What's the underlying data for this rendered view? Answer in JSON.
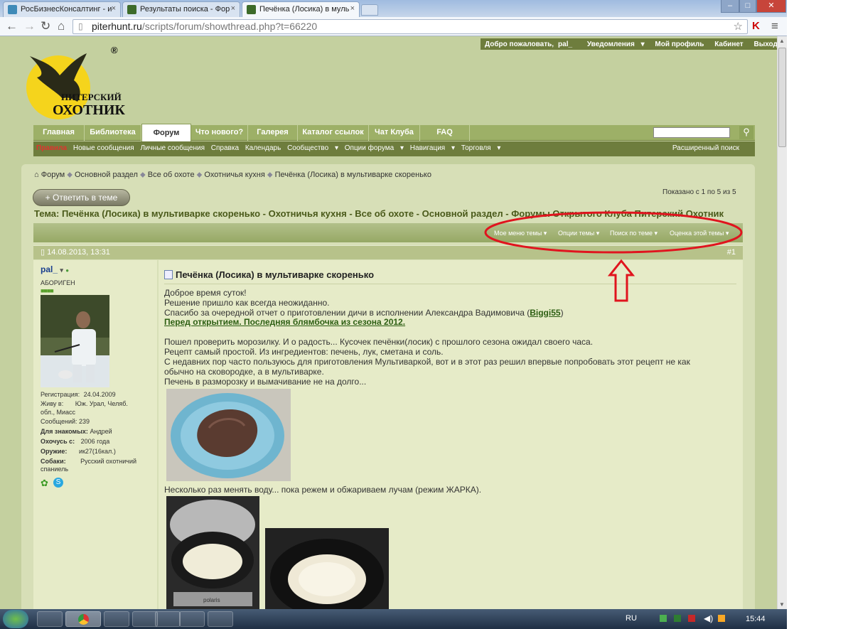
{
  "browser": {
    "tabs": [
      {
        "title": "РосБизнесКонсалтинг - и"
      },
      {
        "title": "Результаты поиска - Фор"
      },
      {
        "title": "Печёнка (Лосика) в муль"
      }
    ],
    "tab_close": "×",
    "url_host": "piterhunt.ru",
    "url_path": "/scripts/forum/showthread.php?t=66220"
  },
  "site": {
    "logo_text": "ПИТЕРСКИЙ ОХОТНИК",
    "registered_mark": "®",
    "userbar": {
      "welcome": "Добро пожаловать,",
      "username": "pal_",
      "notifications": "Уведомления",
      "profile": "Мой профиль",
      "cabinet": "Кабинет",
      "logout": "Выход"
    },
    "nav_tabs": [
      "Главная",
      "Библиотека",
      "Форум",
      "Что нового?",
      "Галерея",
      "Каталог ссылок",
      "Чат Клуба",
      "FAQ"
    ],
    "subnav": [
      "Правила",
      "Новые сообщения",
      "Личные сообщения",
      "Справка",
      "Календарь",
      "Сообщество",
      "Опции форума",
      "Навигация",
      "Торговля"
    ],
    "advanced_search": "Расширенный поиск"
  },
  "breadcrumb": [
    "Форум",
    "Основной раздел",
    "Все об охоте",
    "Охотничья кухня",
    "Печёнка (Лосика) в мультиварке скоренько"
  ],
  "reply_button": "Ответить в теме",
  "showing": "Показано с 1 по 5 из 5",
  "thread_title": "Тема: Печёнка (Лосика) в мультиварке скоренько - Охотничья кухня - Все об охоте - Основной раздел - Форумы Открытого Клуба Питерский Охотник",
  "thread_tools": [
    "Мое меню темы",
    "Опции темы",
    "Поиск по теме",
    "Оценка этой темы"
  ],
  "post": {
    "date": "14.08.2013, 13:31",
    "number": "#1",
    "author": "pal_",
    "rank": "АБОРИГЕН",
    "reg_label": "Регистрация:",
    "reg_value": "24.04.2009",
    "live_label": "Живу в:",
    "live_value": "Юж. Урал, Челяб.",
    "live_value2": "обл., Миасс",
    "posts_label": "Сообщений:",
    "posts_value": "239",
    "friends_label": "Для знакомых:",
    "friends_value": "Андрей",
    "hunt_label": "Охочусь с:",
    "hunt_value": "2006 года",
    "weapon_label": "Оружие:",
    "weapon_value": "ик27(16кал.)",
    "dogs_label": "Собаки:",
    "dogs_value": "Русский охотничий",
    "dogs_value2": "спаниель",
    "title": "Печёнка (Лосика) в мультиварке скоренько",
    "lines": [
      "Доброе время суток!",
      "Решение пришло как всегда неожиданно.",
      "Спасибо за очередной отчет о приготовлении дичи в исполнении Александра Вадимовича (",
      "Biggi55",
      ")",
      "Перед открытием. Последняя блямбочка из сезона 2012.",
      "Пошел проверить морозилку. И о радость... Кусочек печёнки(лосик) с прошлого сезона ожидал своего часа.",
      "Рецепт самый простой. Из ингредиентов: печень, лук, сметана и соль.",
      "С недавних пор часто пользуюсь для приготовления Мультиваркой, вот и в этот раз решил впервые попробовать этот рецепт не как",
      "обычно на сковородке, а в мультиварке.",
      "Печень в разморозку и вымачивание не на долго...",
      "Несколько раз менять воду... пока режем и обжариваем лучам (режим ЖАРКА)."
    ],
    "multicooker_brand": "polaris"
  },
  "taskbar": {
    "lang": "RU",
    "time": "15:44"
  },
  "colors": {
    "annotation": "#e0141e",
    "nav": "#9db067",
    "subnav": "#6e7d3d"
  }
}
